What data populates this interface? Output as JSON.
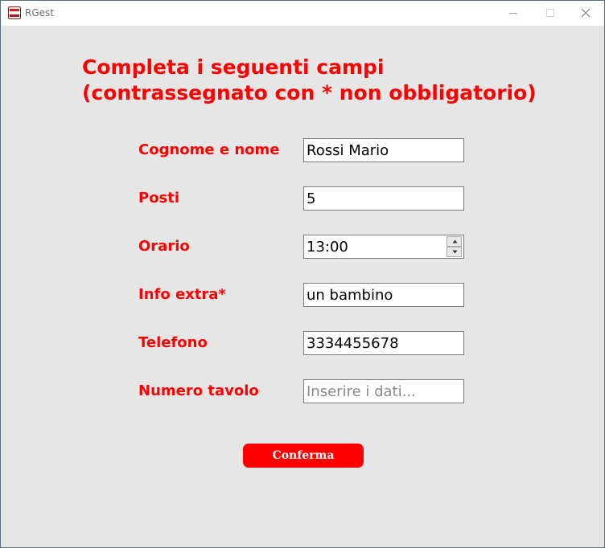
{
  "window": {
    "title": "RGest",
    "app_icon": "restaurant-app-icon",
    "controls": [
      "minimize-icon",
      "maximize-icon",
      "close-icon"
    ]
  },
  "heading": {
    "line1": "Completa i seguenti campi",
    "line2": "(contrassegnato con * non obbligatorio)"
  },
  "form": {
    "fields": [
      {
        "label": "Cognome e nome",
        "value": "Rossi Mario",
        "placeholder": ""
      },
      {
        "label": "Posti",
        "value": "5",
        "placeholder": ""
      },
      {
        "label": "Orario",
        "value": "13:00",
        "placeholder": ""
      },
      {
        "label": "Info extra*",
        "value": "un bambino",
        "placeholder": ""
      },
      {
        "label": "Telefono",
        "value": "3334455678",
        "placeholder": ""
      },
      {
        "label": "Numero tavolo",
        "value": "",
        "placeholder": "Inserire i dati..."
      }
    ],
    "confirm_label": "Conferma"
  },
  "colors": {
    "accent": "#ff0000",
    "background": "#e6e6e6"
  }
}
